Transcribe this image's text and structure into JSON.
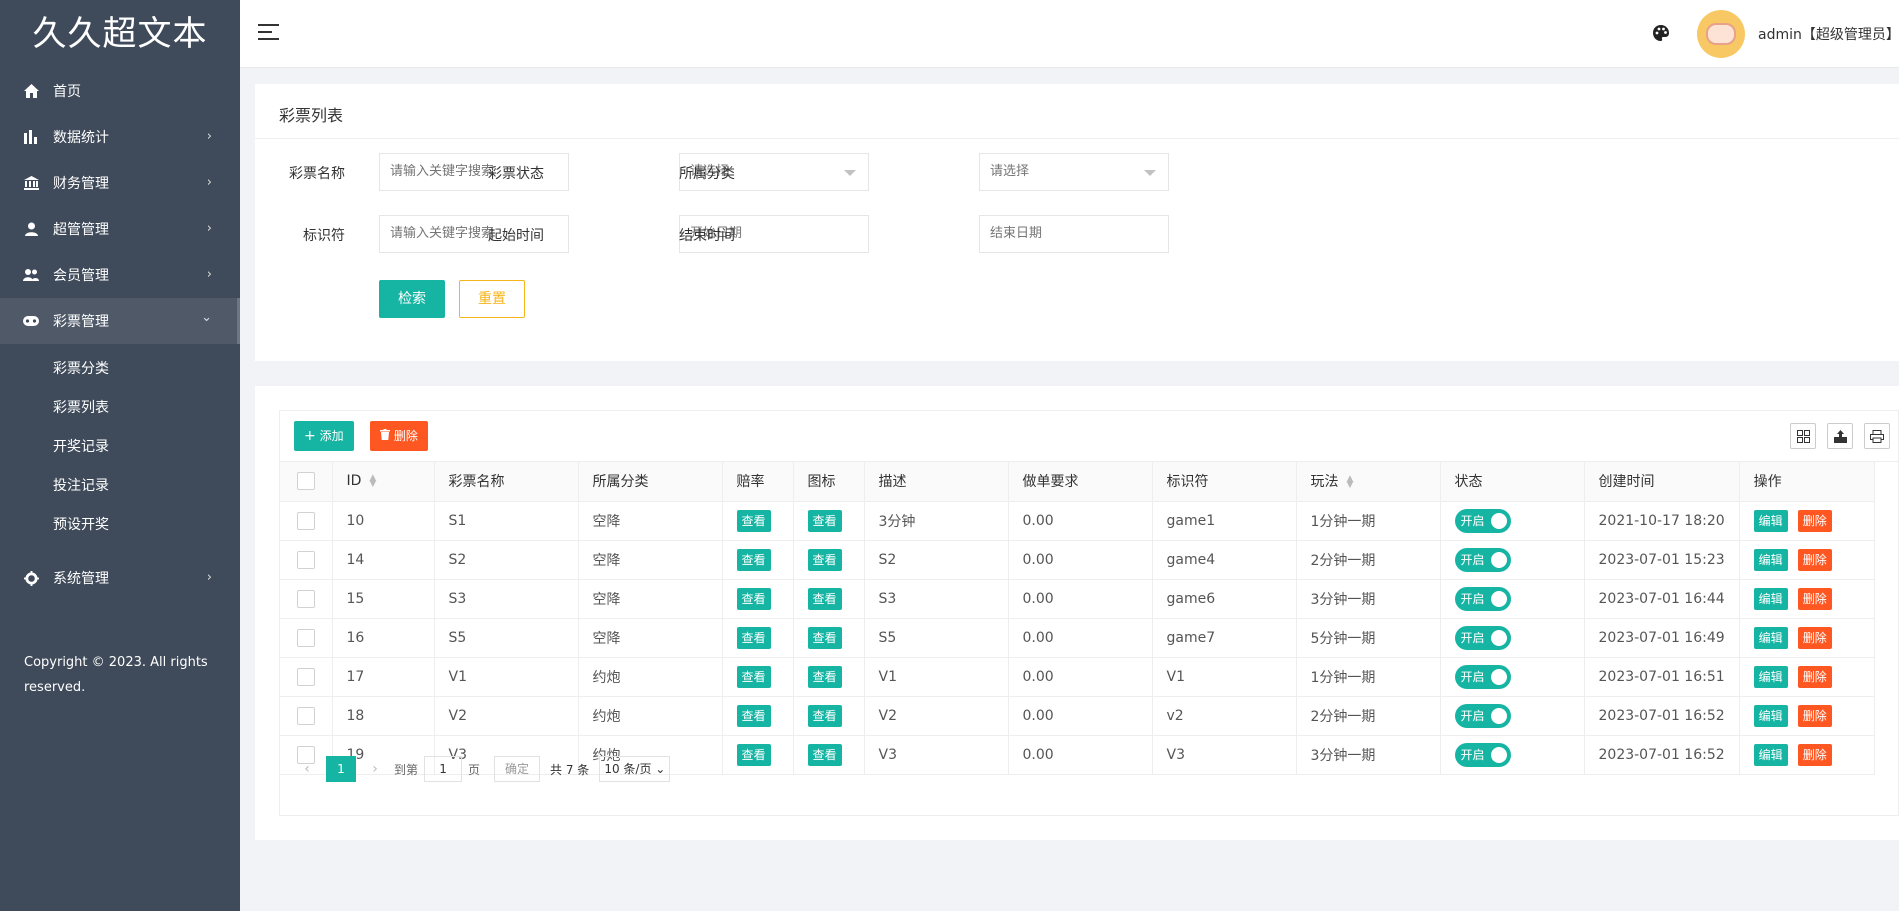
{
  "app": {
    "logo": "久久超文本"
  },
  "sidebar": {
    "items": [
      {
        "label": "首页",
        "icon": "home-icon",
        "arrow": ""
      },
      {
        "label": "数据统计",
        "icon": "bar-chart-icon",
        "arrow": "›"
      },
      {
        "label": "财务管理",
        "icon": "bank-icon",
        "arrow": "›"
      },
      {
        "label": "超管管理",
        "icon": "user-icon",
        "arrow": "›"
      },
      {
        "label": "会员管理",
        "icon": "users-icon",
        "arrow": "›"
      },
      {
        "label": "彩票管理",
        "icon": "gamepad-icon",
        "arrow": "⌄"
      }
    ],
    "subitems": [
      "彩票分类",
      "彩票列表",
      "开奖记录",
      "投注记录",
      "预设开奖"
    ],
    "system": {
      "label": "系统管理",
      "icon": "gear-icon",
      "arrow": "›"
    },
    "copyright": "Copyright © 2023. All rights reserved."
  },
  "header": {
    "user": "admin【超级管理员】",
    "caret": "▾"
  },
  "search": {
    "title": "彩票列表",
    "fields": {
      "name_label": "彩票名称",
      "name_placeholder": "请输入关键字搜索",
      "status_label": "彩票状态",
      "status_value": "请选择",
      "category_label": "所属分类",
      "category_value": "请选择",
      "code_label": "标识符",
      "code_placeholder": "请输入关键字搜索",
      "start_label": "起始时间",
      "start_placeholder": "开始日期",
      "end_label": "结束时间",
      "end_placeholder": "结束日期"
    },
    "search_btn": "检索",
    "reset_btn": "重置"
  },
  "toolbar": {
    "add": "添加",
    "delete": "删除"
  },
  "table": {
    "headers": [
      "ID",
      "彩票名称",
      "所属分类",
      "赔率",
      "图标",
      "描述",
      "做单要求",
      "标识符",
      "玩法",
      "状态",
      "创建时间",
      "操作"
    ],
    "view_label": "查看",
    "switch_label": "开启",
    "edit_label": "编辑",
    "remove_label": "删除",
    "rows": [
      {
        "id": "10",
        "name": "S1",
        "category": "空降",
        "desc": "3分钟",
        "req": "0.00",
        "code": "game1",
        "play": "1分钟一期",
        "created": "2021-10-17 18:20"
      },
      {
        "id": "14",
        "name": "S2",
        "category": "空降",
        "desc": "S2",
        "req": "0.00",
        "code": "game4",
        "play": "2分钟一期",
        "created": "2023-07-01 15:23"
      },
      {
        "id": "15",
        "name": "S3",
        "category": "空降",
        "desc": "S3",
        "req": "0.00",
        "code": "game6",
        "play": "3分钟一期",
        "created": "2023-07-01 16:44"
      },
      {
        "id": "16",
        "name": "S5",
        "category": "空降",
        "desc": "S5",
        "req": "0.00",
        "code": "game7",
        "play": "5分钟一期",
        "created": "2023-07-01 16:49"
      },
      {
        "id": "17",
        "name": "V1",
        "category": "约炮",
        "desc": "V1",
        "req": "0.00",
        "code": "V1",
        "play": "1分钟一期",
        "created": "2023-07-01 16:51"
      },
      {
        "id": "18",
        "name": "V2",
        "category": "约炮",
        "desc": "V2",
        "req": "0.00",
        "code": "v2",
        "play": "2分钟一期",
        "created": "2023-07-01 16:52"
      },
      {
        "id": "19",
        "name": "V3",
        "category": "约炮",
        "desc": "V3",
        "req": "0.00",
        "code": "V3",
        "play": "3分钟一期",
        "created": "2023-07-01 16:52"
      }
    ]
  },
  "pager": {
    "current": "1",
    "goto": "到第",
    "page_input": "1",
    "page": "页",
    "confirm": "确定",
    "total": "共 7 条",
    "size": "10 条/页 ⌄"
  },
  "colors": {
    "sidebar": "#3f4a5a",
    "accent": "#16b5a3",
    "danger": "#ff5722",
    "warning": "#f5b51b"
  }
}
